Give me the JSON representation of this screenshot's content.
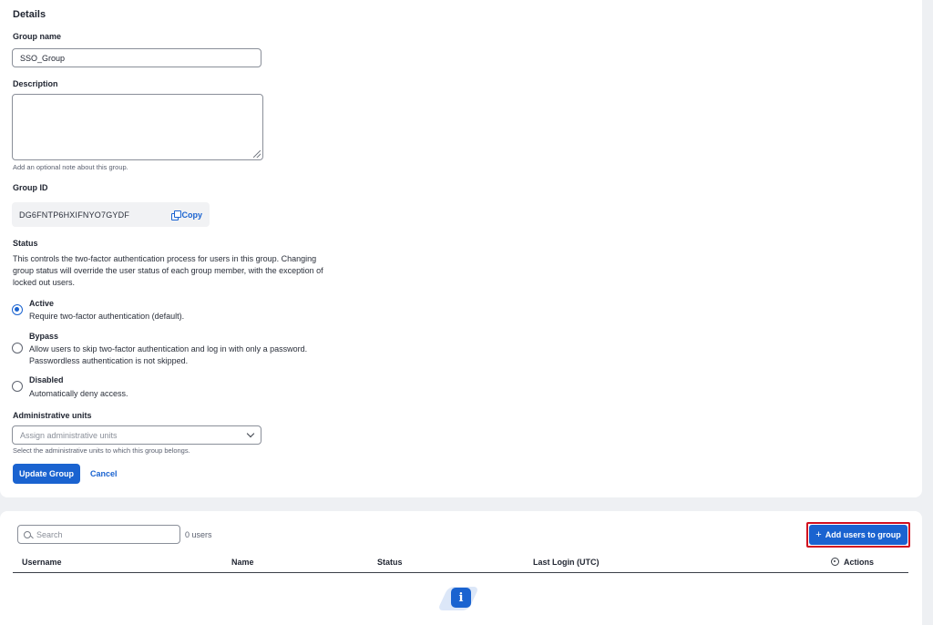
{
  "details": {
    "heading": "Details",
    "group_name": {
      "label": "Group name",
      "value": "SSO_Group"
    },
    "description": {
      "label": "Description",
      "value": "",
      "help": "Add an optional note about this group."
    },
    "group_id": {
      "label": "Group ID",
      "value": "DG6FNTP6HXIFNYO7GYDF",
      "copy_label": "Copy"
    },
    "status": {
      "label": "Status",
      "description_lines": [
        "This controls the two-factor authentication process for users in this group. Changing",
        "group status will override the user status of each group member, with the exception of",
        "locked out users."
      ],
      "options": [
        {
          "title": "Active",
          "desc_lines": [
            "Require two-factor authentication (default)."
          ],
          "checked": true
        },
        {
          "title": "Bypass",
          "desc_lines": [
            "Allow users to skip two-factor authentication and log in with only a password.",
            "Passwordless authentication is not skipped."
          ],
          "checked": false
        },
        {
          "title": "Disabled",
          "desc_lines": [
            "Automatically deny access."
          ],
          "checked": false
        }
      ]
    },
    "admin_units": {
      "label": "Administrative units",
      "placeholder": "Assign administrative units",
      "help": "Select the administrative units to which this group belongs."
    },
    "update_button": "Update Group",
    "cancel_button": "Cancel"
  },
  "users": {
    "search_placeholder": "Search",
    "count": "0 users",
    "add_button": "Add users to group",
    "columns": [
      "Username",
      "Name",
      "Status",
      "Last Login (UTC)",
      "Actions"
    ],
    "rows": []
  },
  "colors": {
    "accent": "#1a63d0",
    "highlight": "#d10f1f",
    "page_bg": "#eef0f3"
  }
}
